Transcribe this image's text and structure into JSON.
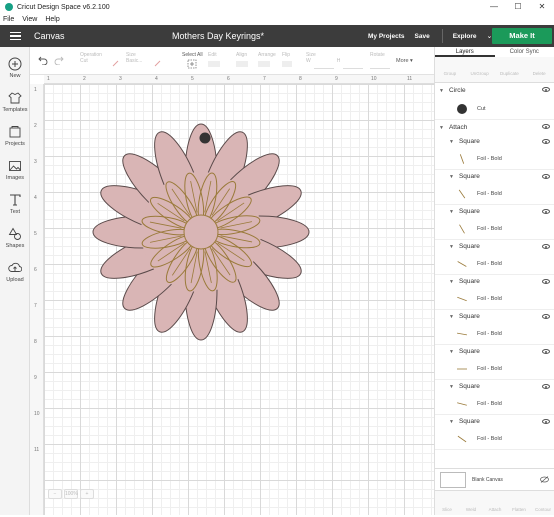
{
  "window": {
    "title": "Cricut Design Space  v6.2.100",
    "minimize": "—",
    "maximize": "☐",
    "close": "✕"
  },
  "menu": [
    "File",
    "View",
    "Help"
  ],
  "header": {
    "section": "Canvas",
    "project_title": "Mothers Day Keyrings*",
    "my_projects": "My Projects",
    "save": "Save",
    "machine": "Explore",
    "make_it": "Make It",
    "accent": "#1b9a5a"
  },
  "left_nav": [
    {
      "label": "New",
      "icon": "plus-icon"
    },
    {
      "label": "Templates",
      "icon": "shirt-icon"
    },
    {
      "label": "Projects",
      "icon": "projects-icon"
    },
    {
      "label": "Images",
      "icon": "images-icon"
    },
    {
      "label": "Text",
      "icon": "text-icon"
    },
    {
      "label": "Shapes",
      "icon": "shapes-icon"
    },
    {
      "label": "Upload",
      "icon": "upload-icon"
    }
  ],
  "toolbar": {
    "operation": "Operation",
    "operation_value": "Cut",
    "size": "Size",
    "size_value": "Basic...",
    "select_all": "Select All",
    "edit": "Edit",
    "align": "Align",
    "arrange": "Arrange",
    "flip": "Flip",
    "size_label": "Size",
    "rotate": "Rotate",
    "more": "More ▾",
    "w": "W",
    "h": "H"
  },
  "ruler": {
    "top": [
      "1",
      "2",
      "3",
      "4",
      "5",
      "6",
      "7",
      "8",
      "9",
      "10",
      "11"
    ],
    "left": [
      "1",
      "2",
      "3",
      "4",
      "5",
      "6",
      "7",
      "8",
      "9",
      "10",
      "11"
    ]
  },
  "zoom": {
    "minus": "−",
    "value": "100%",
    "plus": "+"
  },
  "canvas": {
    "flower_fill": "#d9b5b5",
    "flower_outline": "#5a4a4a",
    "foil_color": "#9a7a3a",
    "hole_color": "#333333"
  },
  "panel": {
    "tabs": [
      "Layers",
      "Color Sync"
    ],
    "actions": [
      "Group",
      "UnGroup",
      "Duplicate",
      "Delete"
    ],
    "layers": {
      "circle": {
        "name": "Circle",
        "op": "Cut"
      },
      "attach": {
        "name": "Attach"
      },
      "children": [
        {
          "name": "Square",
          "op": "Foil - Bold"
        },
        {
          "name": "Square",
          "op": "Foil - Bold"
        },
        {
          "name": "Square",
          "op": "Foil - Bold"
        },
        {
          "name": "Square",
          "op": "Foil - Bold"
        },
        {
          "name": "Square",
          "op": "Foil - Bold"
        },
        {
          "name": "Square",
          "op": "Foil - Bold"
        },
        {
          "name": "Square",
          "op": "Foil - Bold"
        },
        {
          "name": "Square",
          "op": "Foil - Bold"
        },
        {
          "name": "Square",
          "op": "Foil - Bold"
        }
      ]
    },
    "blank_canvas": "Blank Canvas",
    "bottom_actions": [
      "Slice",
      "Weld",
      "Attach",
      "Flatten",
      "Contour"
    ]
  }
}
